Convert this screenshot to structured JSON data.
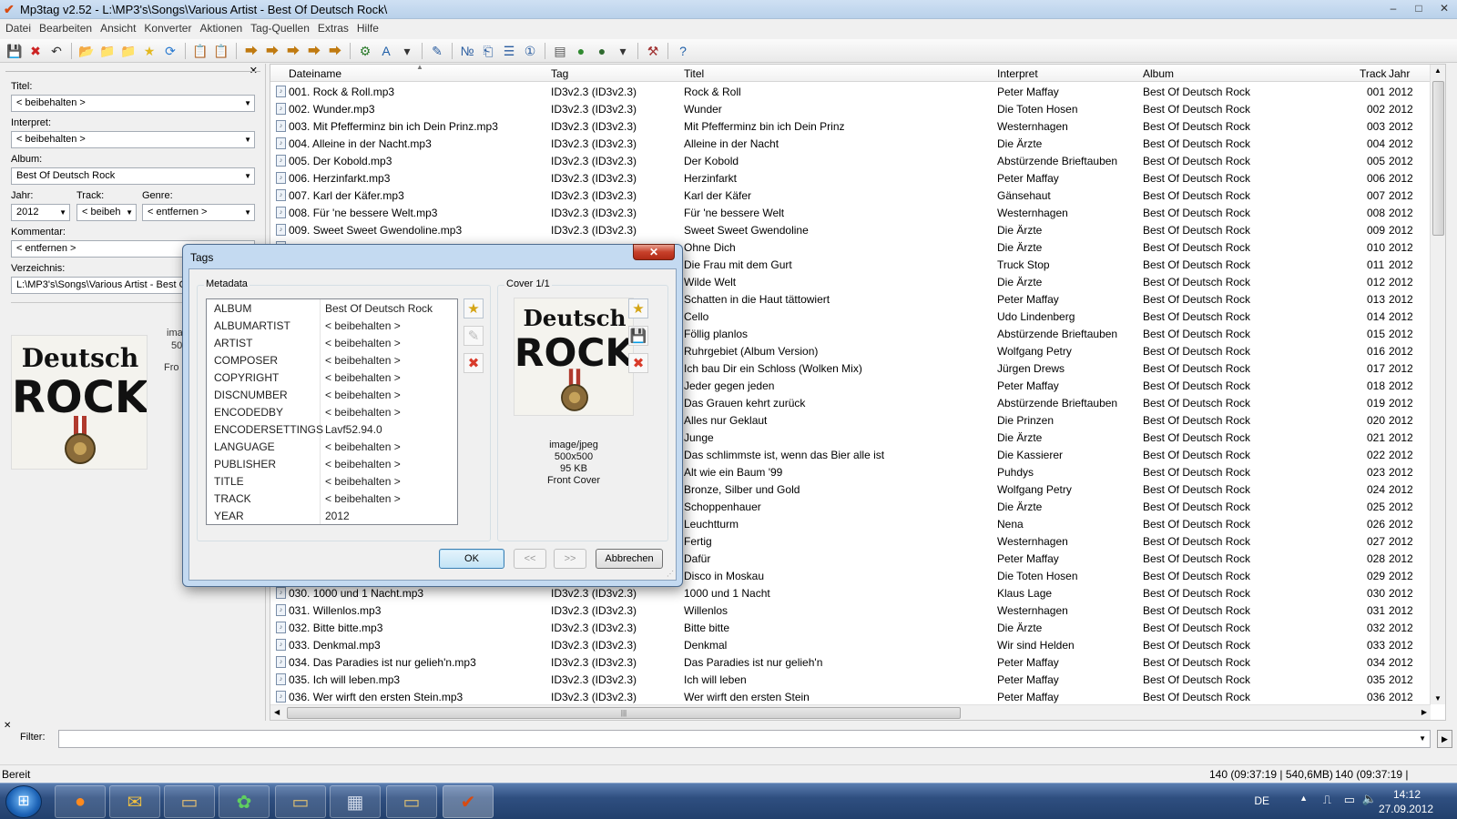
{
  "window": {
    "title": "Mp3tag v2.52  -  L:\\MP3's\\Songs\\Various Artist - Best Of Deutsch Rock\\",
    "controls": [
      "–",
      "□",
      "✕"
    ]
  },
  "menu": [
    "Datei",
    "Bearbeiten",
    "Ansicht",
    "Konverter",
    "Aktionen",
    "Tag-Quellen",
    "Extras",
    "Hilfe"
  ],
  "toolbar": [
    {
      "icon": "save-icon",
      "glyph": "💾",
      "color": "#2b4f8a"
    },
    {
      "icon": "remove-tag-icon",
      "glyph": "✖",
      "color": "#cc2222"
    },
    {
      "icon": "undo-icon",
      "glyph": "↶",
      "color": "#333"
    },
    {
      "sep": true
    },
    {
      "icon": "add-directory-icon",
      "glyph": "📂",
      "color": "#d8a21e"
    },
    {
      "icon": "change-directory-icon",
      "glyph": "📁",
      "color": "#d8a21e"
    },
    {
      "icon": "open-folder-icon",
      "glyph": "📁",
      "color": "#d8a21e"
    },
    {
      "icon": "favorites-icon",
      "glyph": "★",
      "color": "#e3b81f"
    },
    {
      "icon": "refresh-icon",
      "glyph": "⟳",
      "color": "#2a7ad0"
    },
    {
      "sep": true
    },
    {
      "icon": "copy-tag-icon",
      "glyph": "📋",
      "color": "#b98b2a"
    },
    {
      "icon": "paste-tag-icon",
      "glyph": "📋",
      "color": "#b98b2a"
    },
    {
      "sep": true
    },
    {
      "icon": "tag-filename-icon",
      "glyph": "⮕",
      "color": "#c07a10"
    },
    {
      "icon": "filename-tag-icon",
      "glyph": "⮕",
      "color": "#c07a10"
    },
    {
      "icon": "filename-filename-icon",
      "glyph": "⮕",
      "color": "#c07a10"
    },
    {
      "icon": "text-file-tag-icon",
      "glyph": "⮕",
      "color": "#c07a10"
    },
    {
      "icon": "tag-tag-icon",
      "glyph": "⮕",
      "color": "#c07a10"
    },
    {
      "sep": true
    },
    {
      "icon": "actions-icon",
      "glyph": "⚙",
      "color": "#2a7a2a"
    },
    {
      "icon": "case-conversion-icon",
      "glyph": "A",
      "color": "#1f5fa8"
    },
    {
      "icon": "dropdown-arrow-icon",
      "glyph": "▾",
      "color": "#333"
    },
    {
      "sep": true
    },
    {
      "icon": "edit-icon",
      "glyph": "✎",
      "color": "#2a5da0"
    },
    {
      "sep": true
    },
    {
      "icon": "autonumber-icon",
      "glyph": "№",
      "color": "#2a5da0"
    },
    {
      "icon": "export-icon",
      "glyph": "⎗",
      "color": "#2a5da0"
    },
    {
      "icon": "playlist-icon",
      "glyph": "☰",
      "color": "#2a5da0"
    },
    {
      "icon": "numbering-icon",
      "glyph": "①",
      "color": "#2a5da0"
    },
    {
      "sep": true
    },
    {
      "icon": "freedb-icon",
      "glyph": "▤",
      "color": "#555"
    },
    {
      "icon": "web-sources-icon",
      "glyph": "●",
      "color": "#2f8a2f"
    },
    {
      "icon": "tag-sources-icon",
      "glyph": "●",
      "color": "#2f6a2f"
    },
    {
      "icon": "dropdown-arrow-icon",
      "glyph": "▾",
      "color": "#333"
    },
    {
      "sep": true
    },
    {
      "icon": "options-icon",
      "glyph": "⚒",
      "color": "#a03030"
    },
    {
      "sep": true
    },
    {
      "icon": "help-icon",
      "glyph": "?",
      "color": "#1f5fa8"
    }
  ],
  "left_panel": {
    "close": "✕",
    "titel": {
      "label": "Titel:",
      "value": "< beibehalten >"
    },
    "interpret": {
      "label": "Interpret:",
      "value": "< beibehalten >"
    },
    "album": {
      "label": "Album:",
      "value": "Best Of Deutsch Rock"
    },
    "jahr": {
      "label": "Jahr:",
      "value": "2012"
    },
    "track": {
      "label": "Track:",
      "value": "< beibeh"
    },
    "genre": {
      "label": "Genre:",
      "value": "< entfernen >"
    },
    "kommentar": {
      "label": "Kommentar:",
      "value": "< entfernen >"
    },
    "verzeichnis": {
      "label": "Verzeichnis:",
      "value": "L:\\MP3's\\Songs\\Various Artist - Best Of"
    },
    "cover_info": [
      "ima",
      "50",
      "Fro"
    ]
  },
  "cover": {
    "line1": "Deutsch",
    "line2": "ROCK"
  },
  "list": {
    "columns": {
      "dateiname": "Dateiname",
      "tag": "Tag",
      "titel": "Titel",
      "interpret": "Interpret",
      "album": "Album",
      "track": "Track",
      "jahr": "Jahr"
    },
    "rows": [
      {
        "file": "001. Rock & Roll.mp3",
        "tag": "ID3v2.3 (ID3v2.3)",
        "title": "Rock & Roll",
        "artist": "Peter Maffay",
        "album": "Best Of Deutsch Rock",
        "track": "001",
        "year": "2012"
      },
      {
        "file": "002. Wunder.mp3",
        "tag": "ID3v2.3 (ID3v2.3)",
        "title": "Wunder",
        "artist": "Die Toten Hosen",
        "album": "Best Of Deutsch Rock",
        "track": "002",
        "year": "2012"
      },
      {
        "file": "003. Mit Pfefferminz bin ich Dein Prinz.mp3",
        "tag": "ID3v2.3 (ID3v2.3)",
        "title": "Mit Pfefferminz bin ich Dein Prinz",
        "artist": "Westernhagen",
        "album": "Best Of Deutsch Rock",
        "track": "003",
        "year": "2012"
      },
      {
        "file": "004. Alleine in der Nacht.mp3",
        "tag": "ID3v2.3 (ID3v2.3)",
        "title": "Alleine in der Nacht",
        "artist": "Die Ärzte",
        "album": "Best Of Deutsch Rock",
        "track": "004",
        "year": "2012"
      },
      {
        "file": "005. Der Kobold.mp3",
        "tag": "ID3v2.3 (ID3v2.3)",
        "title": "Der Kobold",
        "artist": "Abstürzende Brieftauben",
        "album": "Best Of Deutsch Rock",
        "track": "005",
        "year": "2012"
      },
      {
        "file": "006. Herzinfarkt.mp3",
        "tag": "ID3v2.3 (ID3v2.3)",
        "title": "Herzinfarkt",
        "artist": "Peter Maffay",
        "album": "Best Of Deutsch Rock",
        "track": "006",
        "year": "2012"
      },
      {
        "file": "007. Karl der Käfer.mp3",
        "tag": "ID3v2.3 (ID3v2.3)",
        "title": "Karl der Käfer",
        "artist": "Gänsehaut",
        "album": "Best Of Deutsch Rock",
        "track": "007",
        "year": "2012"
      },
      {
        "file": "008. Für 'ne bessere Welt.mp3",
        "tag": "ID3v2.3 (ID3v2.3)",
        "title": "Für 'ne bessere Welt",
        "artist": "Westernhagen",
        "album": "Best Of Deutsch Rock",
        "track": "008",
        "year": "2012"
      },
      {
        "file": "009. Sweet Sweet Gwendoline.mp3",
        "tag": "ID3v2.3 (ID3v2.3)",
        "title": "Sweet Sweet Gwendoline",
        "artist": "Die Ärzte",
        "album": "Best Of Deutsch Rock",
        "track": "009",
        "year": "2012"
      },
      {
        "file": "",
        "tag": "",
        "title": "Ohne Dich",
        "artist": "Die Ärzte",
        "album": "Best Of Deutsch Rock",
        "track": "010",
        "year": "2012"
      },
      {
        "file": "",
        "tag": "",
        "title": "Die Frau mit dem Gurt",
        "artist": "Truck Stop",
        "album": "Best Of Deutsch Rock",
        "track": "011",
        "year": "2012"
      },
      {
        "file": "",
        "tag": "",
        "title": "Wilde Welt",
        "artist": "Die Ärzte",
        "album": "Best Of Deutsch Rock",
        "track": "012",
        "year": "2012"
      },
      {
        "file": "",
        "tag": "",
        "title": "Schatten in die Haut tättowiert",
        "artist": "Peter Maffay",
        "album": "Best Of Deutsch Rock",
        "track": "013",
        "year": "2012"
      },
      {
        "file": "",
        "tag": "",
        "title": "Cello",
        "artist": "Udo Lindenberg",
        "album": "Best Of Deutsch Rock",
        "track": "014",
        "year": "2012"
      },
      {
        "file": "",
        "tag": "",
        "title": "Föllig planlos",
        "artist": "Abstürzende Brieftauben",
        "album": "Best Of Deutsch Rock",
        "track": "015",
        "year": "2012"
      },
      {
        "file": "",
        "tag": "",
        "title": "Ruhrgebiet (Album Version)",
        "artist": "Wolfgang Petry",
        "album": "Best Of Deutsch Rock",
        "track": "016",
        "year": "2012"
      },
      {
        "file": "",
        "tag": "",
        "title": "Ich bau Dir ein Schloss (Wolken Mix)",
        "artist": "Jürgen Drews",
        "album": "Best Of Deutsch Rock",
        "track": "017",
        "year": "2012"
      },
      {
        "file": "",
        "tag": "",
        "title": "Jeder gegen jeden",
        "artist": "Peter Maffay",
        "album": "Best Of Deutsch Rock",
        "track": "018",
        "year": "2012"
      },
      {
        "file": "",
        "tag": "",
        "title": "Das Grauen kehrt zurück",
        "artist": "Abstürzende Brieftauben",
        "album": "Best Of Deutsch Rock",
        "track": "019",
        "year": "2012"
      },
      {
        "file": "",
        "tag": "",
        "title": "Alles nur Geklaut",
        "artist": "Die Prinzen",
        "album": "Best Of Deutsch Rock",
        "track": "020",
        "year": "2012"
      },
      {
        "file": "",
        "tag": "",
        "title": "Junge",
        "artist": "Die Ärzte",
        "album": "Best Of Deutsch Rock",
        "track": "021",
        "year": "2012"
      },
      {
        "file": "",
        "tag": "",
        "title": "Das schlimmste ist, wenn das Bier alle ist",
        "artist": "Die Kassierer",
        "album": "Best Of Deutsch Rock",
        "track": "022",
        "year": "2012"
      },
      {
        "file": "",
        "tag": "",
        "title": "Alt wie ein Baum '99",
        "artist": "Puhdys",
        "album": "Best Of Deutsch Rock",
        "track": "023",
        "year": "2012"
      },
      {
        "file": "",
        "tag": "",
        "title": "Bronze, Silber und Gold",
        "artist": "Wolfgang Petry",
        "album": "Best Of Deutsch Rock",
        "track": "024",
        "year": "2012"
      },
      {
        "file": "",
        "tag": "",
        "title": "Schoppenhauer",
        "artist": "Die Ärzte",
        "album": "Best Of Deutsch Rock",
        "track": "025",
        "year": "2012"
      },
      {
        "file": "",
        "tag": "",
        "title": "Leuchtturm",
        "artist": "Nena",
        "album": "Best Of Deutsch Rock",
        "track": "026",
        "year": "2012"
      },
      {
        "file": "",
        "tag": "",
        "title": "Fertig",
        "artist": "Westernhagen",
        "album": "Best Of Deutsch Rock",
        "track": "027",
        "year": "2012"
      },
      {
        "file": "",
        "tag": "",
        "title": "Dafür",
        "artist": "Peter Maffay",
        "album": "Best Of Deutsch Rock",
        "track": "028",
        "year": "2012"
      },
      {
        "file": "",
        "tag": "",
        "title": "Disco in Moskau",
        "artist": "Die Toten Hosen",
        "album": "Best Of Deutsch Rock",
        "track": "029",
        "year": "2012"
      },
      {
        "file": "030. 1000 und 1 Nacht.mp3",
        "tag": "ID3v2.3 (ID3v2.3)",
        "title": "1000 und 1 Nacht",
        "artist": "Klaus Lage",
        "album": "Best Of Deutsch Rock",
        "track": "030",
        "year": "2012"
      },
      {
        "file": "031. Willenlos.mp3",
        "tag": "ID3v2.3 (ID3v2.3)",
        "title": "Willenlos",
        "artist": "Westernhagen",
        "album": "Best Of Deutsch Rock",
        "track": "031",
        "year": "2012"
      },
      {
        "file": "032. Bitte bitte.mp3",
        "tag": "ID3v2.3 (ID3v2.3)",
        "title": "Bitte bitte",
        "artist": "Die Ärzte",
        "album": "Best Of Deutsch Rock",
        "track": "032",
        "year": "2012"
      },
      {
        "file": "033. Denkmal.mp3",
        "tag": "ID3v2.3 (ID3v2.3)",
        "title": "Denkmal",
        "artist": "Wir sind Helden",
        "album": "Best Of Deutsch Rock",
        "track": "033",
        "year": "2012"
      },
      {
        "file": "034. Das Paradies ist nur gelieh'n.mp3",
        "tag": "ID3v2.3 (ID3v2.3)",
        "title": "Das Paradies ist nur gelieh'n",
        "artist": "Peter Maffay",
        "album": "Best Of Deutsch Rock",
        "track": "034",
        "year": "2012"
      },
      {
        "file": "035. Ich will leben.mp3",
        "tag": "ID3v2.3 (ID3v2.3)",
        "title": "Ich will leben",
        "artist": "Peter Maffay",
        "album": "Best Of Deutsch Rock",
        "track": "035",
        "year": "2012"
      },
      {
        "file": "036. Wer wirft den ersten Stein.mp3",
        "tag": "ID3v2.3 (ID3v2.3)",
        "title": "Wer wirft den ersten Stein",
        "artist": "Peter Maffay",
        "album": "Best Of Deutsch Rock",
        "track": "036",
        "year": "2012"
      }
    ]
  },
  "dialog": {
    "title": "Tags",
    "close": "✕",
    "metadata_label": "Metadata",
    "cover_label": "Cover 1/1",
    "fields": [
      {
        "k": "ALBUM",
        "v": "Best Of Deutsch Rock"
      },
      {
        "k": "ALBUMARTIST",
        "v": "< beibehalten >"
      },
      {
        "k": "ARTIST",
        "v": "< beibehalten >"
      },
      {
        "k": "COMPOSER",
        "v": "< beibehalten >"
      },
      {
        "k": "COPYRIGHT",
        "v": "< beibehalten >"
      },
      {
        "k": "DISCNUMBER",
        "v": "< beibehalten >"
      },
      {
        "k": "ENCODEDBY",
        "v": "< beibehalten >"
      },
      {
        "k": "ENCODERSETTINGS",
        "v": "Lavf52.94.0"
      },
      {
        "k": "LANGUAGE",
        "v": "< beibehalten >"
      },
      {
        "k": "PUBLISHER",
        "v": "< beibehalten >"
      },
      {
        "k": "TITLE",
        "v": "< beibehalten >"
      },
      {
        "k": "TRACK",
        "v": "< beibehalten >"
      },
      {
        "k": "YEAR",
        "v": "2012"
      }
    ],
    "cover_info": {
      "type": "image/jpeg",
      "size": "500x500",
      "bytes": "95 KB",
      "kind": "Front Cover"
    },
    "buttons": {
      "ok": "OK",
      "prev": "<<",
      "next": ">>",
      "cancel": "Abbrechen"
    }
  },
  "filter": {
    "close": "✕",
    "label": "Filter:",
    "value": ""
  },
  "status": {
    "left": "Bereit",
    "right1": "140 (09:37:19 | 540,6MB)",
    "right2": "140 (09:37:19 | 540,6MB)"
  },
  "taskbar": {
    "lang": "DE",
    "time": "14:12",
    "date": "27.09.2012"
  },
  "colors": {
    "accent": "#3c7fb1",
    "taskbar": "#2f4f80"
  }
}
